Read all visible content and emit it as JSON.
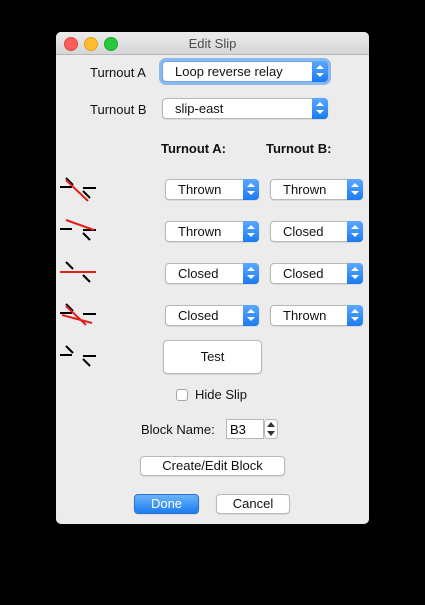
{
  "window": {
    "title": "Edit Slip"
  },
  "turnout_a": {
    "label": "Turnout A",
    "value": "Loop reverse relay"
  },
  "turnout_b": {
    "label": "Turnout B",
    "value": "slip-east"
  },
  "column_headers": {
    "a": "Turnout A:",
    "b": "Turnout B:"
  },
  "states": [
    {
      "a": "Thrown",
      "b": "Thrown",
      "icon": "slip-state-1-icon"
    },
    {
      "a": "Thrown",
      "b": "Closed",
      "icon": "slip-state-2-icon"
    },
    {
      "a": "Closed",
      "b": "Closed",
      "icon": "slip-state-3-icon"
    },
    {
      "a": "Closed",
      "b": "Thrown",
      "icon": "slip-state-4-icon"
    }
  ],
  "test_button": "Test",
  "hide_slip": {
    "label": "Hide Slip",
    "checked": false
  },
  "block": {
    "label": "Block Name:",
    "value": "B3"
  },
  "create_edit_block_button": "Create/Edit Block",
  "done_button": "Done",
  "cancel_button": "Cancel",
  "colors": {
    "track_red": "#e0201e",
    "accent_blue": "#1b7df1"
  }
}
